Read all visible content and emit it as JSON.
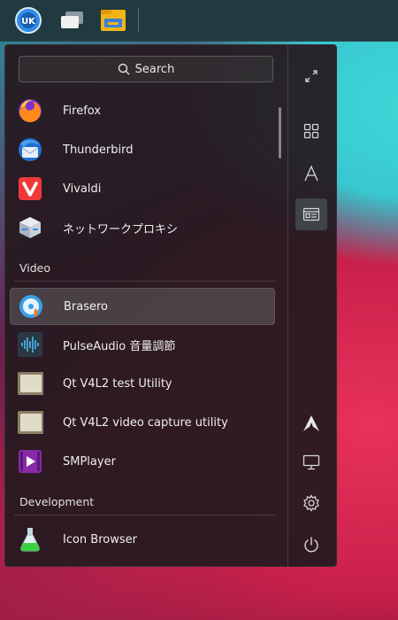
{
  "search": {
    "placeholder": "Search"
  },
  "apps_top": [
    {
      "label": "Firefox",
      "icon": "firefox-icon"
    },
    {
      "label": "Thunderbird",
      "icon": "thunderbird-icon"
    },
    {
      "label": "Vivaldi",
      "icon": "vivaldi-icon"
    },
    {
      "label": "ネットワークプロキシ",
      "icon": "network-proxy-icon"
    }
  ],
  "sections": {
    "video": "Video",
    "development": "Development"
  },
  "apps_video": [
    {
      "label": "Brasero",
      "icon": "brasero-icon",
      "selected": true
    },
    {
      "label": "PulseAudio 音量調節",
      "icon": "pulseaudio-icon"
    },
    {
      "label": "Qt V4L2 test Utility",
      "icon": "qt-v4l2-icon"
    },
    {
      "label": "Qt V4L2 video capture utility",
      "icon": "qt-v4l2-capture-icon"
    },
    {
      "label": "SMPlayer",
      "icon": "smplayer-icon"
    }
  ],
  "apps_dev": [
    {
      "label": "Icon Browser",
      "icon": "icon-browser-icon"
    }
  ],
  "colors": {
    "accent": "#1793d1",
    "menu_bg": "#261a20"
  }
}
